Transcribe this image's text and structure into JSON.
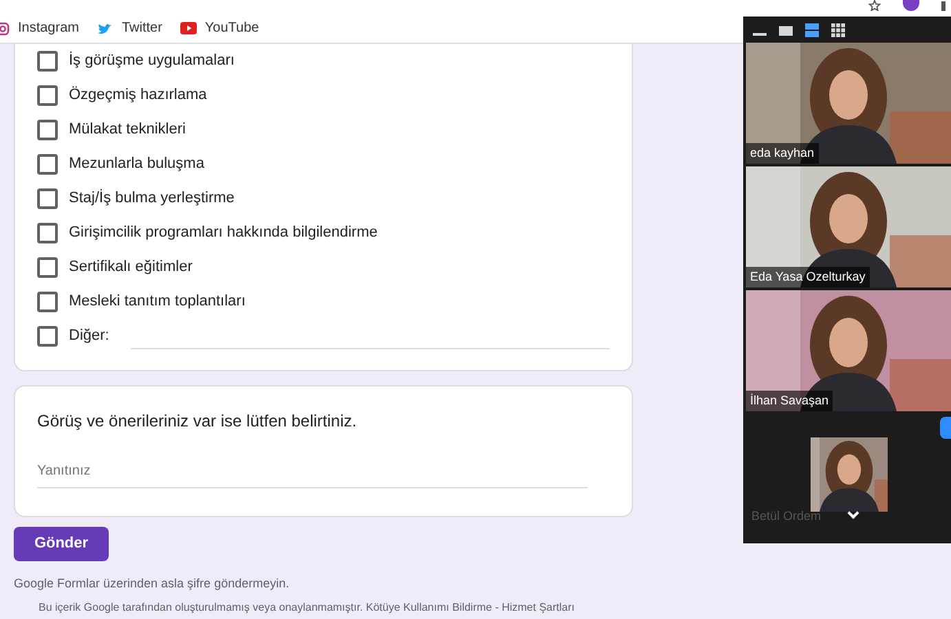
{
  "bookmarks": [
    {
      "kind": "instagram",
      "label": "Instagram"
    },
    {
      "kind": "twitter",
      "label": "Twitter"
    },
    {
      "kind": "youtube",
      "label": "YouTube"
    }
  ],
  "options": [
    {
      "label": "İş görüşme uygulamaları",
      "checked": false
    },
    {
      "label": "Özgeçmiş hazırlama",
      "checked": false
    },
    {
      "label": "Mülakat teknikleri",
      "checked": false
    },
    {
      "label": "Mezunlarla buluşma",
      "checked": false
    },
    {
      "label": "Staj/İş bulma yerleştirme",
      "checked": false
    },
    {
      "label": "Girişimcilik programları hakkında bilgilendirme",
      "checked": false
    },
    {
      "label": "Sertifikalı eğitimler",
      "checked": false
    },
    {
      "label": "Mesleki tanıtım toplantıları",
      "checked": false
    }
  ],
  "other_option": {
    "label": "Diğer:",
    "checked": false
  },
  "question": {
    "title": "Görüş ve önerileriniz var ise lütfen belirtiniz.",
    "placeholder": "Yanıtınız"
  },
  "submit_button": "Gönder",
  "notice": "Google Formlar üzerinden asla şifre göndermeyin.",
  "footer": "Bu içerik Google tarafından oluşturulmamış veya onaylanmamıştır. Kötüye Kullanımı Bildirme - Hizmet Şartları",
  "video_panel": {
    "views": [
      {
        "kind": "minimize",
        "selected": false
      },
      {
        "kind": "single",
        "selected": false
      },
      {
        "kind": "stack",
        "selected": true
      },
      {
        "kind": "grid",
        "selected": false
      }
    ],
    "participants": [
      {
        "name": "eda kayhan",
        "kind": "large"
      },
      {
        "name": "Eda Yasa Ozelturkay",
        "kind": "large"
      },
      {
        "name": "İlhan Savaşan",
        "kind": "large"
      },
      {
        "name": "Betül Ordem",
        "kind": "small"
      }
    ]
  }
}
